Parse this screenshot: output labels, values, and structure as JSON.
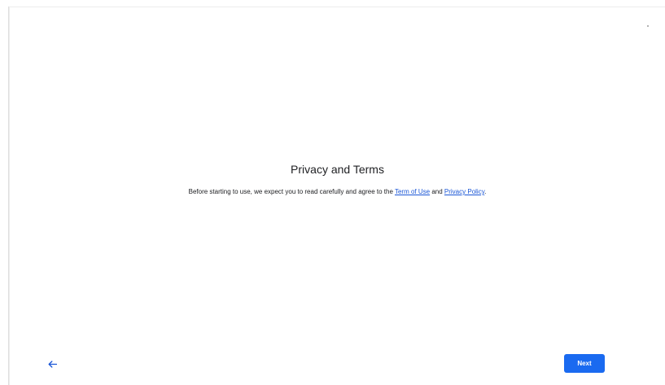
{
  "page": {
    "title": "Privacy and Terms",
    "description_prefix": "Before starting to use, we expect you to read carefully and agree to the ",
    "terms_link": "Term of Use",
    "description_middle": " and ",
    "privacy_link": "Privacy Policy",
    "description_suffix": "."
  },
  "navigation": {
    "back_icon": "arrow-left-icon",
    "next_label": "Next"
  },
  "colors": {
    "accent": "#1a6af0",
    "link": "#1a56d6",
    "text": "#202124",
    "background": "#ffffff"
  }
}
